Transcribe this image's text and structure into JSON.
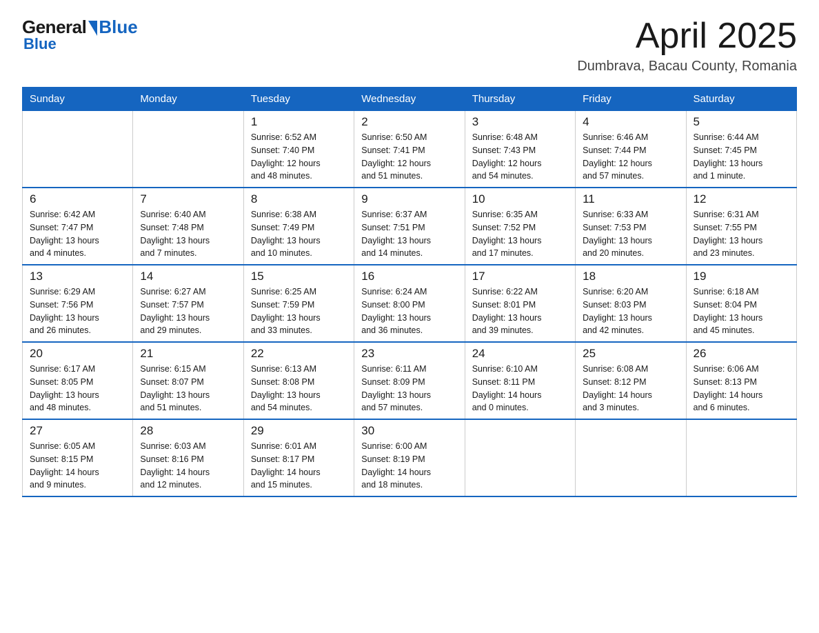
{
  "logo": {
    "general": "General",
    "blue": "Blue"
  },
  "header": {
    "title": "April 2025",
    "location": "Dumbrava, Bacau County, Romania"
  },
  "days_of_week": [
    "Sunday",
    "Monday",
    "Tuesday",
    "Wednesday",
    "Thursday",
    "Friday",
    "Saturday"
  ],
  "weeks": [
    [
      {
        "day": "",
        "info": ""
      },
      {
        "day": "",
        "info": ""
      },
      {
        "day": "1",
        "info": "Sunrise: 6:52 AM\nSunset: 7:40 PM\nDaylight: 12 hours\nand 48 minutes."
      },
      {
        "day": "2",
        "info": "Sunrise: 6:50 AM\nSunset: 7:41 PM\nDaylight: 12 hours\nand 51 minutes."
      },
      {
        "day": "3",
        "info": "Sunrise: 6:48 AM\nSunset: 7:43 PM\nDaylight: 12 hours\nand 54 minutes."
      },
      {
        "day": "4",
        "info": "Sunrise: 6:46 AM\nSunset: 7:44 PM\nDaylight: 12 hours\nand 57 minutes."
      },
      {
        "day": "5",
        "info": "Sunrise: 6:44 AM\nSunset: 7:45 PM\nDaylight: 13 hours\nand 1 minute."
      }
    ],
    [
      {
        "day": "6",
        "info": "Sunrise: 6:42 AM\nSunset: 7:47 PM\nDaylight: 13 hours\nand 4 minutes."
      },
      {
        "day": "7",
        "info": "Sunrise: 6:40 AM\nSunset: 7:48 PM\nDaylight: 13 hours\nand 7 minutes."
      },
      {
        "day": "8",
        "info": "Sunrise: 6:38 AM\nSunset: 7:49 PM\nDaylight: 13 hours\nand 10 minutes."
      },
      {
        "day": "9",
        "info": "Sunrise: 6:37 AM\nSunset: 7:51 PM\nDaylight: 13 hours\nand 14 minutes."
      },
      {
        "day": "10",
        "info": "Sunrise: 6:35 AM\nSunset: 7:52 PM\nDaylight: 13 hours\nand 17 minutes."
      },
      {
        "day": "11",
        "info": "Sunrise: 6:33 AM\nSunset: 7:53 PM\nDaylight: 13 hours\nand 20 minutes."
      },
      {
        "day": "12",
        "info": "Sunrise: 6:31 AM\nSunset: 7:55 PM\nDaylight: 13 hours\nand 23 minutes."
      }
    ],
    [
      {
        "day": "13",
        "info": "Sunrise: 6:29 AM\nSunset: 7:56 PM\nDaylight: 13 hours\nand 26 minutes."
      },
      {
        "day": "14",
        "info": "Sunrise: 6:27 AM\nSunset: 7:57 PM\nDaylight: 13 hours\nand 29 minutes."
      },
      {
        "day": "15",
        "info": "Sunrise: 6:25 AM\nSunset: 7:59 PM\nDaylight: 13 hours\nand 33 minutes."
      },
      {
        "day": "16",
        "info": "Sunrise: 6:24 AM\nSunset: 8:00 PM\nDaylight: 13 hours\nand 36 minutes."
      },
      {
        "day": "17",
        "info": "Sunrise: 6:22 AM\nSunset: 8:01 PM\nDaylight: 13 hours\nand 39 minutes."
      },
      {
        "day": "18",
        "info": "Sunrise: 6:20 AM\nSunset: 8:03 PM\nDaylight: 13 hours\nand 42 minutes."
      },
      {
        "day": "19",
        "info": "Sunrise: 6:18 AM\nSunset: 8:04 PM\nDaylight: 13 hours\nand 45 minutes."
      }
    ],
    [
      {
        "day": "20",
        "info": "Sunrise: 6:17 AM\nSunset: 8:05 PM\nDaylight: 13 hours\nand 48 minutes."
      },
      {
        "day": "21",
        "info": "Sunrise: 6:15 AM\nSunset: 8:07 PM\nDaylight: 13 hours\nand 51 minutes."
      },
      {
        "day": "22",
        "info": "Sunrise: 6:13 AM\nSunset: 8:08 PM\nDaylight: 13 hours\nand 54 minutes."
      },
      {
        "day": "23",
        "info": "Sunrise: 6:11 AM\nSunset: 8:09 PM\nDaylight: 13 hours\nand 57 minutes."
      },
      {
        "day": "24",
        "info": "Sunrise: 6:10 AM\nSunset: 8:11 PM\nDaylight: 14 hours\nand 0 minutes."
      },
      {
        "day": "25",
        "info": "Sunrise: 6:08 AM\nSunset: 8:12 PM\nDaylight: 14 hours\nand 3 minutes."
      },
      {
        "day": "26",
        "info": "Sunrise: 6:06 AM\nSunset: 8:13 PM\nDaylight: 14 hours\nand 6 minutes."
      }
    ],
    [
      {
        "day": "27",
        "info": "Sunrise: 6:05 AM\nSunset: 8:15 PM\nDaylight: 14 hours\nand 9 minutes."
      },
      {
        "day": "28",
        "info": "Sunrise: 6:03 AM\nSunset: 8:16 PM\nDaylight: 14 hours\nand 12 minutes."
      },
      {
        "day": "29",
        "info": "Sunrise: 6:01 AM\nSunset: 8:17 PM\nDaylight: 14 hours\nand 15 minutes."
      },
      {
        "day": "30",
        "info": "Sunrise: 6:00 AM\nSunset: 8:19 PM\nDaylight: 14 hours\nand 18 minutes."
      },
      {
        "day": "",
        "info": ""
      },
      {
        "day": "",
        "info": ""
      },
      {
        "day": "",
        "info": ""
      }
    ]
  ]
}
